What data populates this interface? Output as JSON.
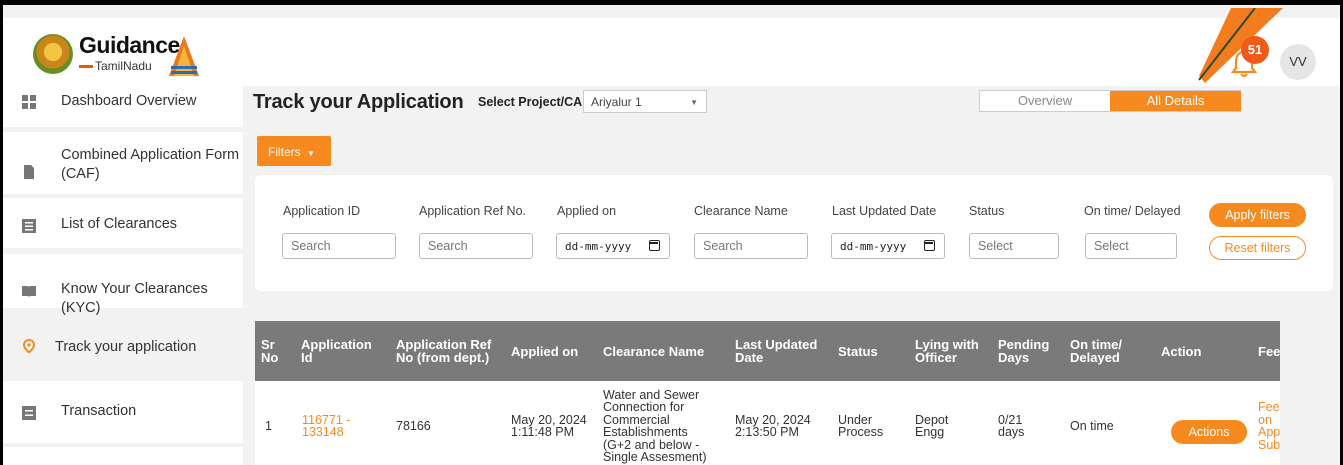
{
  "header": {
    "logo": {
      "name": "Guidance",
      "sub": "TamilNadu"
    },
    "notification_count": "51",
    "user_initials": "VV"
  },
  "sidebar": {
    "items": [
      {
        "label": "Dashboard Overview",
        "icon": "dashboard-icon"
      },
      {
        "label": "Combined Application Form (CAF)",
        "icon": "document-icon"
      },
      {
        "label": "List of Clearances",
        "icon": "list-icon"
      },
      {
        "label": "Know Your Clearances (KYC)",
        "icon": "book-icon"
      },
      {
        "label": "Track your application",
        "icon": "location-pin-icon",
        "active": true
      },
      {
        "label": "Transaction",
        "icon": "transaction-icon"
      }
    ]
  },
  "main": {
    "title": "Track your Application",
    "select_label": "Select Project/CAF",
    "project_value": "Ariyalur 1",
    "view_tabs": {
      "overview": "Overview",
      "all": "All Details"
    },
    "filters_label": "Filters"
  },
  "filters": {
    "labels": {
      "app_id": "Application ID",
      "ref_no": "Application Ref No.",
      "applied_on": "Applied on",
      "clearance": "Clearance Name",
      "last_updated": "Last Updated Date",
      "status": "Status",
      "ontime": "On time/ Delayed"
    },
    "placeholders": {
      "search": "Search",
      "date": "dd-mm-yyyy",
      "select": "Select"
    },
    "apply_label": "Apply filters",
    "reset_label": "Reset filters"
  },
  "table": {
    "headers": {
      "sr": "Sr No",
      "app_id": "Application Id",
      "ref": "Application Ref No (from dept.)",
      "applied": "Applied on",
      "clearance": "Clearance Name",
      "updated": "Last Updated Date",
      "status": "Status",
      "lying": "Lying with Officer",
      "pending": "Pending Days",
      "ontime": "On time/ Delayed",
      "action": "Action",
      "feedback": "Feedback"
    },
    "rows": [
      {
        "sr": "1",
        "app_id": "116771 - 133148",
        "ref": "78166",
        "applied": "May 20, 2024 1:11:48 PM",
        "clearance": "Water and Sewer Connection for Commercial Establishments (G+2 and below - Single Assesment)",
        "updated": "May 20, 2024 2:13:50 PM",
        "status": "Under Process",
        "lying": "Depot Engg",
        "pending": "0/21 days",
        "ontime": "On time",
        "action": "Actions",
        "feedback": "Feedback on Application Submission"
      }
    ]
  },
  "colors": {
    "accent": "#f68a1f",
    "table_header": "#7a7a7a"
  }
}
